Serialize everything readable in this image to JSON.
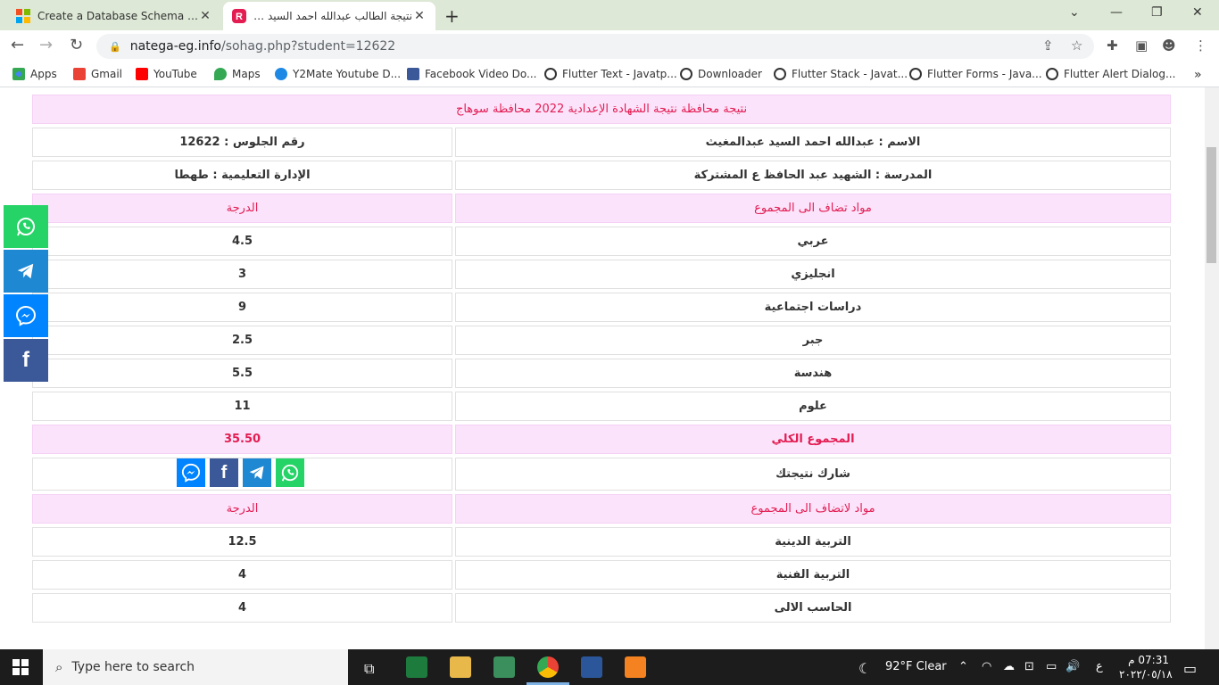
{
  "browser": {
    "tabs": [
      {
        "title": "Create a Database Schema - SQL",
        "active": false
      },
      {
        "title": "نتيجة الطالب عبدالله احمد السيد عبد",
        "active": true
      }
    ],
    "url_domain": "natega-eg.info",
    "url_path": "/sohag.php?student=12622",
    "bookmarks": [
      {
        "label": "Apps",
        "icon": "apps-grid-icon"
      },
      {
        "label": "Gmail",
        "icon": "gmail-icon"
      },
      {
        "label": "YouTube",
        "icon": "youtube-icon"
      },
      {
        "label": "Maps",
        "icon": "maps-icon"
      },
      {
        "label": "Y2Mate Youtube D...",
        "icon": "y2mate-icon"
      },
      {
        "label": "Facebook Video Do...",
        "icon": "facebook-icon"
      },
      {
        "label": "Flutter Text - Javatp...",
        "icon": "globe-icon"
      },
      {
        "label": "Downloader",
        "icon": "globe-icon"
      },
      {
        "label": "Flutter Stack - Javat...",
        "icon": "globe-icon"
      },
      {
        "label": "Flutter Forms - Java...",
        "icon": "globe-icon"
      },
      {
        "label": "Flutter Alert Dialog...",
        "icon": "globe-icon"
      }
    ]
  },
  "page": {
    "header": "نتيجة محافظة نتيجة الشهادة الإعدادية 2022 محافظة سوهاج",
    "name": "الاسم : عبدالله احمد السيد عبدالمغيث",
    "seat": "رقم الجلوس : 12622",
    "school": "المدرسة : الشهيد عبد الحافظ ع المشتركة",
    "admin": "الإدارة التعليمية : طهطا",
    "section1_subject_header": "مواد تضاف الى المجموع",
    "section1_grade_header": "الدرجة",
    "section1_rows": [
      {
        "subject": "عربي",
        "grade": "4.5"
      },
      {
        "subject": "انجليزي",
        "grade": "3"
      },
      {
        "subject": "دراسات اجتماعية",
        "grade": "9"
      },
      {
        "subject": "جبر",
        "grade": "2.5"
      },
      {
        "subject": "هندسة",
        "grade": "5.5"
      },
      {
        "subject": "علوم",
        "grade": "11"
      }
    ],
    "total_label": "المجموع الكلي",
    "total_value": "35.50",
    "share_label": "شارك نتيجتك",
    "section2_subject_header": "مواد لاتضاف الى المجموع",
    "section2_grade_header": "الدرجة",
    "section2_rows": [
      {
        "subject": "التربية الدينية",
        "grade": "12.5"
      },
      {
        "subject": "التربية الفنية",
        "grade": "4"
      },
      {
        "subject": "الحاسب الالى",
        "grade": "4"
      }
    ]
  },
  "taskbar": {
    "search_placeholder": "Type here to search",
    "weather": "92°F  Clear",
    "lang": "ع",
    "time": "07:31 م",
    "date": "٢٠٢٢/٠٥/١٨"
  },
  "colors": {
    "pink_bg": "#fbe4fb",
    "accent_red": "#e31c52",
    "whatsapp": "#25d366",
    "telegram": "#1e88d2",
    "messenger": "#0084ff",
    "facebook": "#3b5998"
  }
}
